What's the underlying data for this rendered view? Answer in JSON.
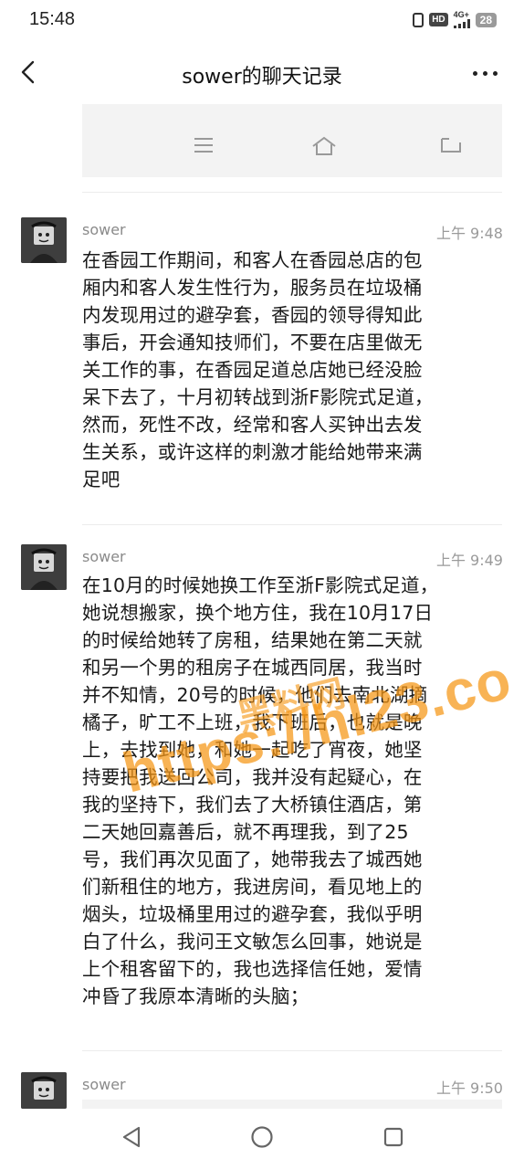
{
  "status_bar": {
    "time": "15:48",
    "network": "4G+",
    "battery": "28"
  },
  "header": {
    "title": "sower的聊天记录"
  },
  "messages": [
    {
      "sender": "sower",
      "time": "上午 9:48",
      "lines": [
        "在香园工作期间，和客人在香园总店的包",
        "厢内和客人发生性行为，服务员在垃圾桶",
        "内发现用过的避孕套，香园的领导得知此",
        "事后，开会通知技师们，不要在店里做无",
        "关工作的事，在香园足道总店她已经没脸",
        "呆下去了，十月初转战到浙F影院式足道，",
        "然而，死性不改，经常和客人买钟出去发",
        "生关系，或许这样的刺激才能给她带来满",
        "足吧"
      ]
    },
    {
      "sender": "sower",
      "time": "上午 9:49",
      "lines": [
        "在10月的时候她换工作至浙F影院式足道，",
        "她说想搬家，换个地方住，我在10月17日",
        "的时候给她转了房租，结果她在第二天就",
        "和另一个男的租房子在城西同居，我当时",
        "并不知情，20号的时候，他们去南北湖摘",
        "橘子，旷工不上班，我下班后，也就是晚",
        "上，去找到她，和她一起吃了宵夜，她坚",
        "持要把我送回公司，我并没有起疑心，在",
        "我的坚持下，我们去了大桥镇住酒店，第",
        "二天她回嘉善后，就不再理我，到了25",
        "号，我们再次见面了，她带我去了城西她",
        "们新租住的地方，我进房间，看见地上的",
        "烟头，垃圾桶里用过的避孕套，我似乎明",
        "白了什么，我问王文敏怎么回事，她说是",
        "上个租客留下的，我也选择信任她，爱情",
        "冲昏了我原本清晰的头脑；"
      ]
    },
    {
      "sender": "sower",
      "time": "上午 9:50"
    }
  ],
  "watermark": {
    "text": "https://hl23.co",
    "text_cn": "黑料网"
  },
  "icons": [
    "back-icon",
    "more-icon",
    "menu-icon",
    "home-icon",
    "return-icon",
    "nav-back-icon",
    "nav-home-icon",
    "nav-recent-icon"
  ]
}
